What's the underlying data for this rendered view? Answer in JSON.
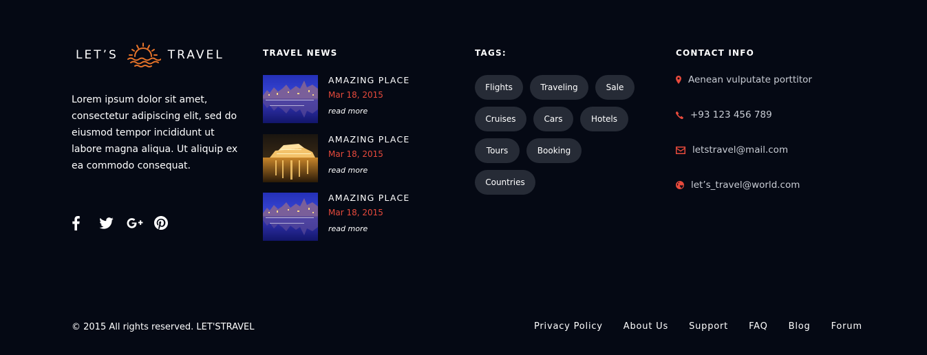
{
  "brand": {
    "word_left": "LET’S",
    "word_right": "TRAVEL",
    "logo_color": "#e8742a"
  },
  "about": {
    "text": "Lorem ipsum dolor sit amet, consectetur adipiscing elit, sed do eiusmod tempor incididunt ut labore magna aliqua. Ut aliquip ex ea commodo consequat."
  },
  "social": [
    {
      "name": "facebook-icon"
    },
    {
      "name": "twitter-icon"
    },
    {
      "name": "google-plus-icon"
    },
    {
      "name": "pinterest-icon"
    }
  ],
  "news": {
    "heading": "TRAVEL NEWS",
    "items": [
      {
        "title": "AMAZING PLACE",
        "date": "Mar 18, 2015",
        "more": "read more",
        "thumb": "blue-night-city"
      },
      {
        "title": "AMAZING PLACE",
        "date": "Mar 18, 2015",
        "more": "read more",
        "thumb": "golden-night-ship"
      },
      {
        "title": "AMAZING PLACE",
        "date": "Mar 18, 2015",
        "more": "read more",
        "thumb": "blue-night-city"
      }
    ]
  },
  "tags": {
    "heading": "TAGS:",
    "items": [
      "Flights",
      "Traveling",
      "Sale",
      "Cruises",
      "Cars",
      "Hotels",
      "Tours",
      "Booking",
      "Countries"
    ]
  },
  "contact": {
    "heading": "CONTACT INFO",
    "address": "Aenean vulputate porttitor",
    "phone": "+93 123 456 789",
    "email": "letstravel@mail.com",
    "web": "let’s_travel@world.com",
    "icon_color": "#e84a3c"
  },
  "footer": {
    "copyright": "© 2015 All rights reserved. LET'STRAVEL",
    "links": [
      "Privacy Policy",
      "About Us",
      "Support",
      "FAQ",
      "Blog",
      "Forum"
    ]
  }
}
